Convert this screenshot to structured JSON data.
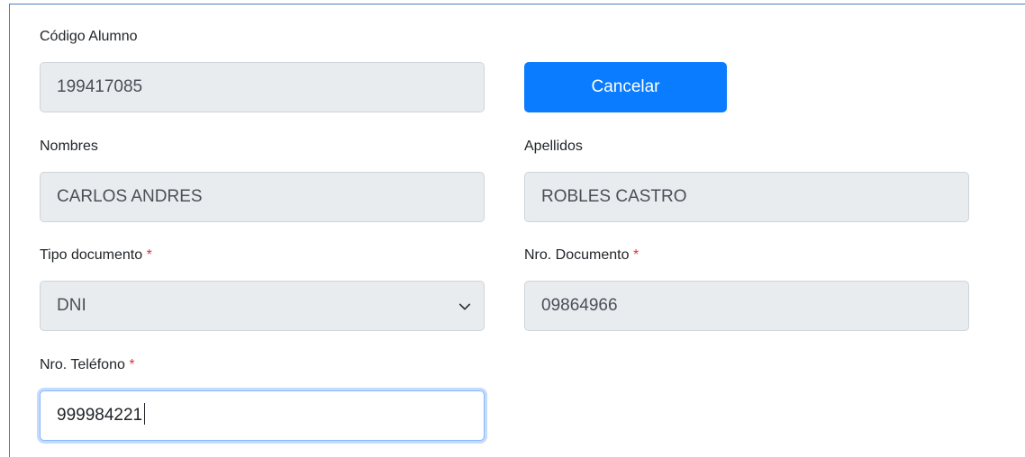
{
  "form": {
    "codigo_alumno": {
      "label": "Código Alumno",
      "value": "199417085"
    },
    "cancel_button": {
      "label": "Cancelar"
    },
    "nombres": {
      "label": "Nombres",
      "value": "CARLOS ANDRES"
    },
    "apellidos": {
      "label": "Apellidos",
      "value": "ROBLES CASTRO"
    },
    "tipo_documento": {
      "label": "Tipo documento",
      "required_mark": "*",
      "selected": "DNI",
      "icon": "chevron-down-icon"
    },
    "nro_documento": {
      "label": "Nro. Documento",
      "required_mark": "*",
      "value": "09864966"
    },
    "nro_telefono": {
      "label": "Nro. Teléfono",
      "required_mark": "*",
      "value": "999984221"
    }
  },
  "colors": {
    "primary_button": "#0a7cff",
    "disabled_field_bg": "#e9ecef",
    "required_mark": "#dc3545",
    "frame_border": "#4a7ebb"
  }
}
